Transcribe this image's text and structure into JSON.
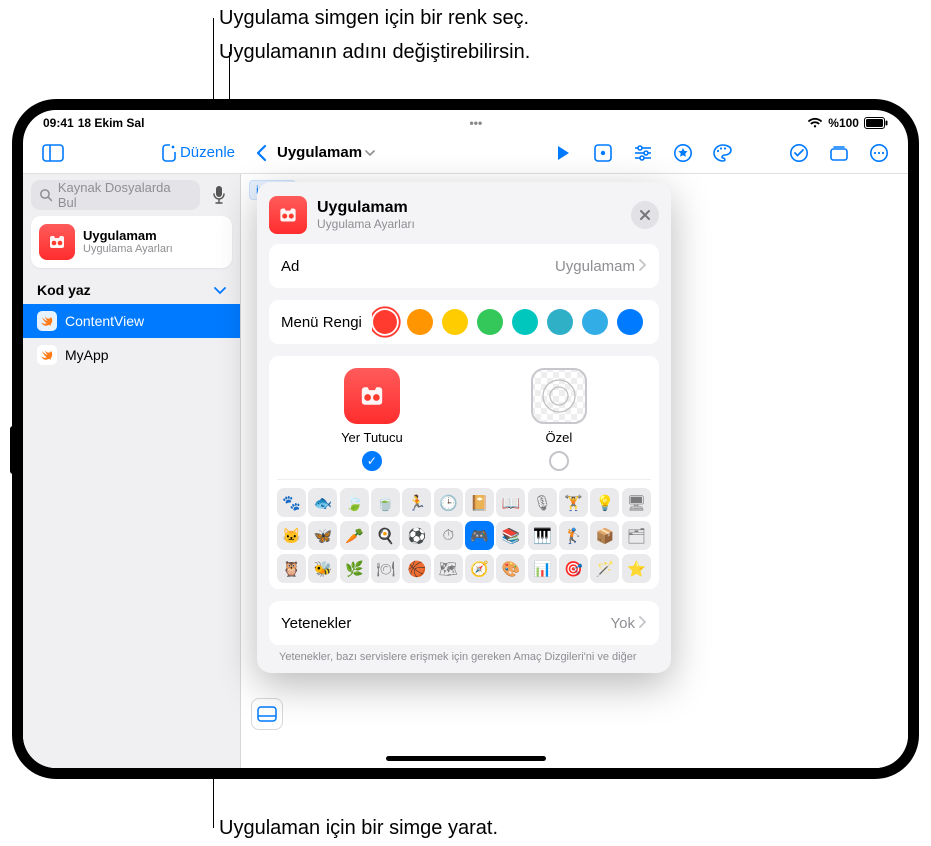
{
  "callouts": {
    "c1": "Uygulama simgen için bir renk seç.",
    "c2": "Uygulamanın adını değiştirebilirsin.",
    "c3": "Uygulaman için bir simge yarat."
  },
  "statusbar": {
    "time": "09:41",
    "date": "18 Ekim Sal",
    "battery": "%100"
  },
  "toolbar": {
    "edit": "Düzenle",
    "title": "Uygulamam"
  },
  "search": {
    "placeholder": "Kaynak Dosyalarda Bul"
  },
  "sidebar": {
    "app_title": "Uygulamam",
    "app_sub": "Uygulama Ayarları",
    "section": "Kod yaz",
    "items": [
      "ContentView",
      "MyApp"
    ]
  },
  "popover": {
    "title": "Uygulamam",
    "subtitle": "Uygulama Ayarları",
    "name_label": "Ad",
    "name_value": "Uygulamam",
    "color_label": "Menü Rengi",
    "colors": [
      "#ff3b30",
      "#ff9500",
      "#ffcc00",
      "#34c759",
      "#00c7be",
      "#30b0c7",
      "#32ade6",
      "#007aff",
      "#5856d6",
      "#af52de"
    ],
    "icon_placeholder": "Yer Tutucu",
    "icon_custom": "Özel",
    "caps_label": "Yetenekler",
    "caps_value": "Yok",
    "footnote": "Yetenekler, bazı servislere erişmek için gereken Amaç Dizgileri'ni ve diğer",
    "grid_icons": [
      "🐾",
      "🐟",
      "🍃",
      "🍵",
      "🏃",
      "🕒",
      "📔",
      "📖",
      "🎙",
      "🏋",
      "💡",
      "🖥",
      "🐱",
      "🦋",
      "🥕",
      "🍳",
      "⚽",
      "⏱",
      "🎮",
      "📚",
      "🎹",
      "🏌",
      "📦",
      "🗂",
      "🦉",
      "🐝",
      "🌿",
      "🍽",
      "🏀",
      "🗺",
      "🧭",
      "🎨",
      "📊",
      "🎯",
      "🪄",
      "⭐"
    ],
    "grid_selected_index": 18
  }
}
